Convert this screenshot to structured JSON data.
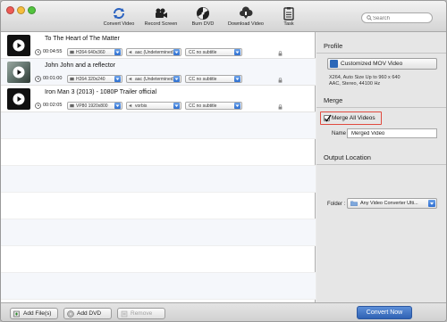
{
  "toolbar": {
    "items": [
      {
        "label": "Convert Video",
        "icon": "convert-icon"
      },
      {
        "label": "Record Screen",
        "icon": "camera-icon"
      },
      {
        "label": "Burn DVD",
        "icon": "disc-icon"
      },
      {
        "label": "Download Video",
        "icon": "download-cloud-icon"
      },
      {
        "label": "Task",
        "icon": "task-clipboard-icon"
      }
    ],
    "search_placeholder": "Search"
  },
  "videos": [
    {
      "title": "To The Heart of The Matter",
      "duration": "00:04:55",
      "video_codec": "H264 640x360",
      "audio": "aac (Undetermined)",
      "subtitle": "no subtitle"
    },
    {
      "title": "John John and a reflector",
      "duration": "00:01:00",
      "video_codec": "H264 320x240",
      "audio": "aac (Undetermined)",
      "subtitle": "no subtitle"
    },
    {
      "title": "Iron Man 3 (2013) - 1080P Trailer official",
      "duration": "00:02:05",
      "video_codec": "VP80 1920x800",
      "audio": "vorbis",
      "subtitle": "no subtitle"
    }
  ],
  "subtitle_prefix": "CC",
  "panel": {
    "profile_title": "Profile",
    "profile_button": "Customized MOV Video",
    "profile_desc_line1": "X264, Auto Size Up to 960 x 640",
    "profile_desc_line2": "AAC, Stereo, 44100 Hz",
    "merge_title": "Merge",
    "merge_checkbox_label": "Merge All Videos",
    "merge_checked": true,
    "name_label": "Name",
    "name_value": "Merged Video",
    "output_title": "Output Location",
    "folder_label": "Folder :",
    "folder_value": "Any Video Converter Ulti..."
  },
  "bottom": {
    "add_files": "Add File(s)",
    "add_dvd": "Add DVD",
    "remove": "Remove",
    "convert": "Convert Now"
  },
  "colors": {
    "highlight": "#e04a3f",
    "accent": "#2f62b4"
  }
}
